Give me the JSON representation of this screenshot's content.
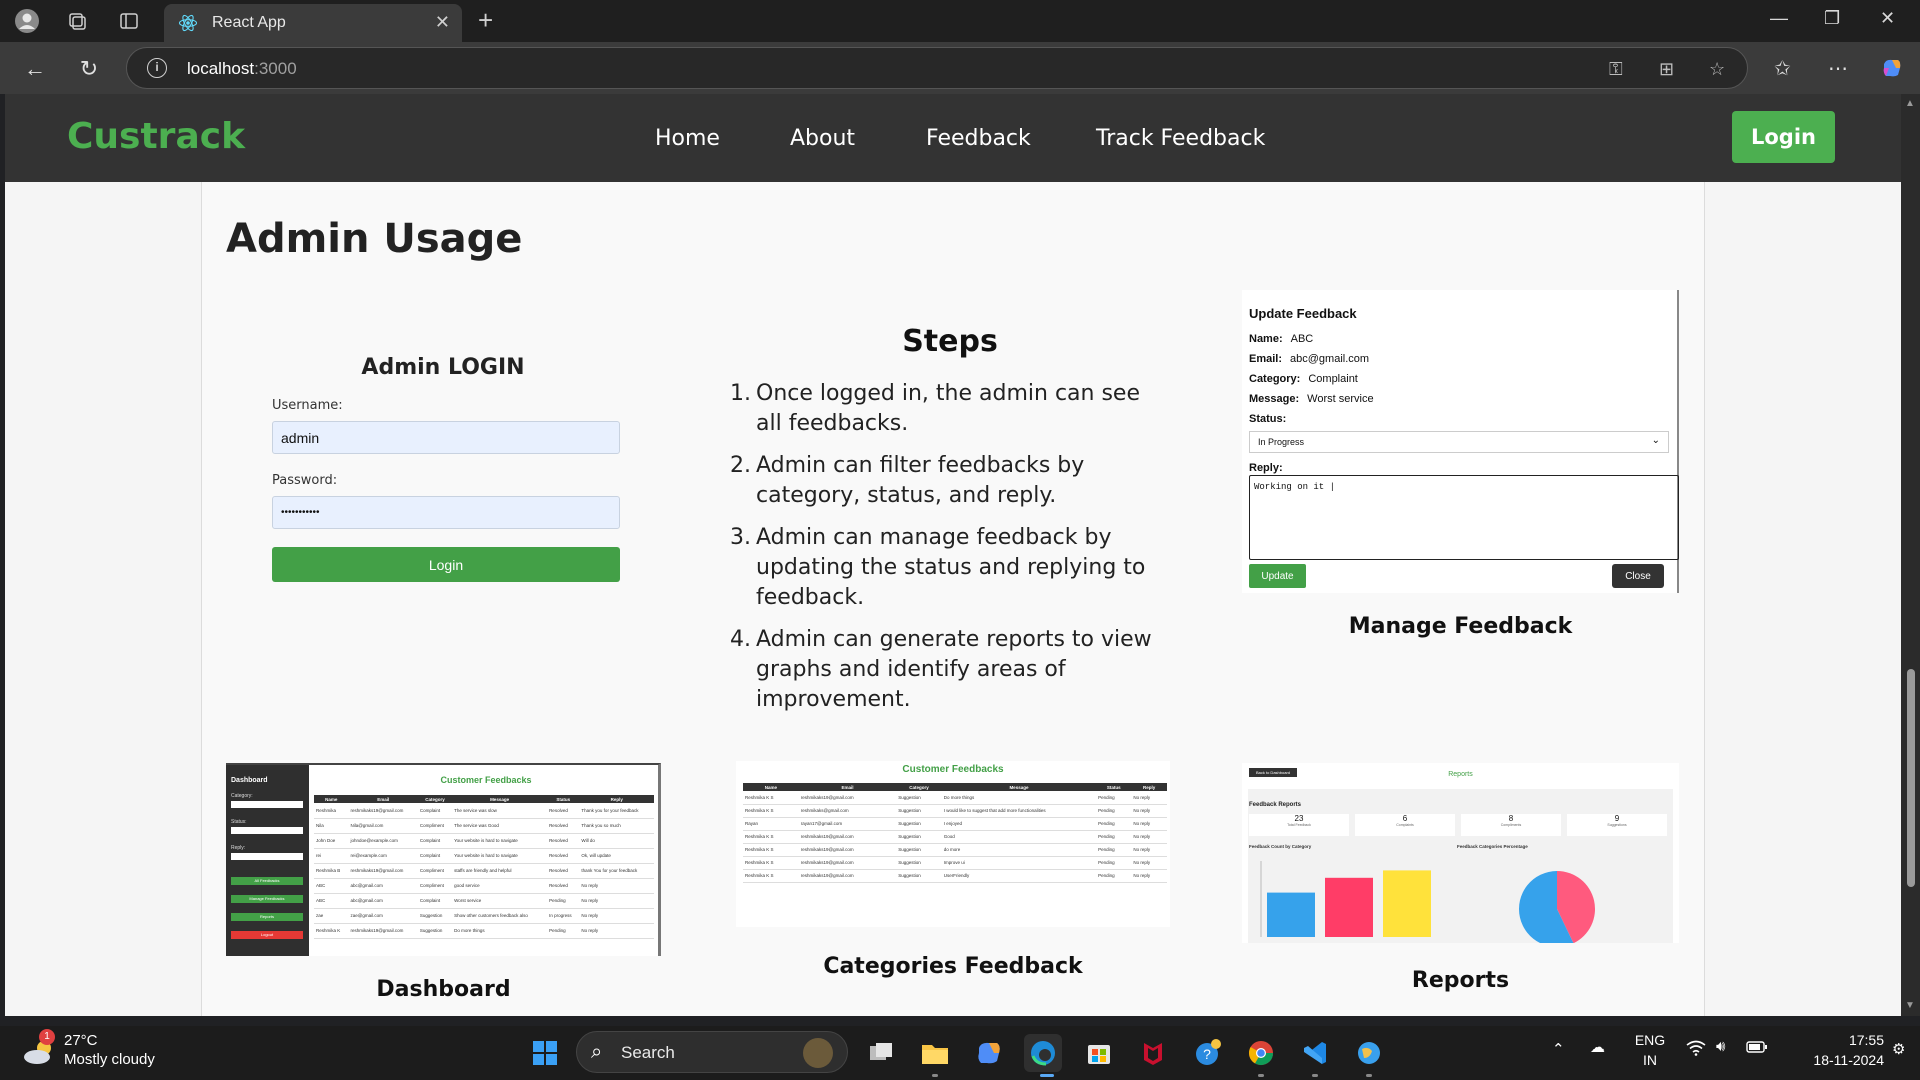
{
  "browser": {
    "tab_title": "React App",
    "url_host": "localhost",
    "url_port": ":3000"
  },
  "site": {
    "brand": "Custrack",
    "nav": [
      "Home",
      "About",
      "Feedback",
      "Track Feedback"
    ],
    "login_button": "Login"
  },
  "section": {
    "title": "Admin Usage"
  },
  "admin_login": {
    "title": "Admin LOGIN",
    "username_label": "Username:",
    "username_value": "admin",
    "password_label": "Password:",
    "password_value": "•••••••••••",
    "button": "Login"
  },
  "steps": {
    "title": "Steps",
    "items": [
      "Once logged in, the admin can see all feedbacks.",
      "Admin can filter feedbacks by category, status, and reply.",
      "Admin can manage feedback by updating the status and replying to feedback.",
      "Admin can generate reports to view graphs and identify areas of improvement."
    ]
  },
  "update_feedback": {
    "title": "Update Feedback",
    "name_label": "Name:",
    "name_value": "ABC",
    "email_label": "Email:",
    "email_value": "abc@gmail.com",
    "category_label": "Category:",
    "category_value": "Complaint",
    "message_label": "Message:",
    "message_value": "Worst service",
    "status_label": "Status:",
    "status_value": "In Progress",
    "reply_label": "Reply:",
    "reply_value": "Working on it |",
    "update_button": "Update",
    "close_button": "Close"
  },
  "captions": {
    "manage": "Manage Feedback",
    "dashboard": "Dashboard",
    "categories": "Categories Feedback",
    "reports": "Reports"
  },
  "dashboard_mock": {
    "sidebar_title": "Dashboard",
    "filters": [
      "Category:",
      "Status:",
      "Reply:"
    ],
    "buttons": [
      "All Feedbacks",
      "Manage Feedbacks",
      "Reports",
      "Logout"
    ],
    "title": "Customer Feedbacks",
    "headers": [
      "Name",
      "Email",
      "Category",
      "Message",
      "Status",
      "Reply"
    ],
    "rows": [
      [
        "Reshmika",
        "reshmikaks19@gmail.com",
        "Complaint",
        "The service was slow",
        "Resolved",
        "Thank you for your feedback"
      ],
      [
        "Nila",
        "Nila@gmail.com",
        "Compliment",
        "The service was Good",
        "Resolved",
        "Thank you so much"
      ],
      [
        "John Doe",
        "johndoe@example.com",
        "Complaint",
        "Your website is hard to navigate",
        "Resolved",
        "Will do"
      ],
      [
        "rei",
        "rei@example.com",
        "Complaint",
        "Your website is hard to navigate",
        "Resolved",
        "Ok, will update"
      ],
      [
        "Reshmika B",
        "reshmikaks19@gmail.com",
        "Compliment",
        "staffs are friendly and helpful",
        "Resolved",
        "thank You for your feedback"
      ],
      [
        "ABC",
        "abc@gmail.com",
        "Compliment",
        "good service",
        "Resolved",
        "No reply"
      ],
      [
        "ABC",
        "abc@gmail.com",
        "Complaint",
        "Worst service",
        "Pending",
        "No reply"
      ],
      [
        "zae",
        "zae@gmail.com",
        "Suggestion",
        "Show other customers feedback also",
        "In progress",
        "No reply"
      ],
      [
        "Reshmika K",
        "reshmikaks19@gmail.com",
        "Suggestion",
        "Do more things",
        "Pending",
        "No reply"
      ]
    ]
  },
  "categories_mock": {
    "title": "Customer Feedbacks",
    "headers": [
      "Name",
      "Email",
      "Category",
      "Message",
      "Status",
      "Reply"
    ],
    "rows": [
      [
        "Reshmika K S",
        "reshmikaks19@gmail.com",
        "Suggestion",
        "Do more things",
        "Pending",
        "No reply"
      ],
      [
        "Reshmika K S",
        "reshmikaks@gmail.com",
        "Suggestion",
        "I would like to suggest that add more functionalities",
        "Pending",
        "No reply"
      ],
      [
        "Rayan",
        "rayan17@gmail.com",
        "Suggestion",
        "I enjoyed",
        "Pending",
        "No reply"
      ],
      [
        "Reshmika K S",
        "reshmikaks19@gmail.com",
        "Suggestion",
        "Good",
        "Pending",
        "No reply"
      ],
      [
        "Reshmika K S",
        "reshmikaks19@gmail.com",
        "Suggestion",
        "do more",
        "Pending",
        "No reply"
      ],
      [
        "Reshmika K S",
        "reshmikaks19@gmail.com",
        "Suggestion",
        "Improve ui",
        "Pending",
        "No reply"
      ],
      [
        "Reshmika K S",
        "reshmikaks19@gmail.com",
        "Suggestion",
        "UserFriendly",
        "Pending",
        "No reply"
      ]
    ]
  },
  "reports_mock": {
    "back_button": "Back to Dashboard",
    "title": "Reports",
    "heading": "Feedback Reports",
    "stats": [
      {
        "value": "23",
        "label": "Total Feedback"
      },
      {
        "value": "6",
        "label": "Complaints"
      },
      {
        "value": "8",
        "label": "Compliments"
      },
      {
        "value": "9",
        "label": "Suggestions"
      }
    ],
    "bar_title": "Feedback Count by Category",
    "pie_title": "Feedback Categories Percentage",
    "bar_values": [
      6,
      8,
      9
    ],
    "bar_colors": [
      "#36a2eb",
      "#ff3d67",
      "#ffe23b"
    ],
    "pie_colors": [
      "#ff5a7e",
      "#36a2eb"
    ]
  },
  "taskbar": {
    "weather_temp": "27°C",
    "weather_desc": "Mostly cloudy",
    "weather_badge": "1",
    "search": "Search",
    "lang_1": "ENG",
    "lang_2": "IN",
    "time": "17:55",
    "date": "18-11-2024"
  }
}
